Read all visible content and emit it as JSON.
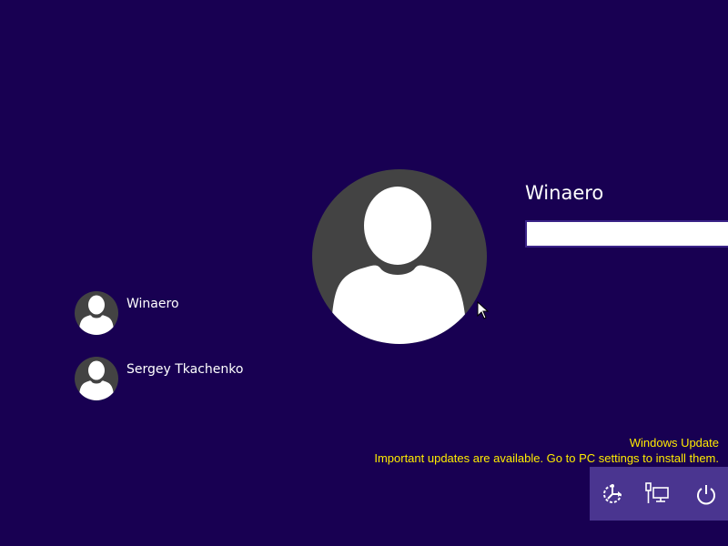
{
  "selected_user": {
    "name": "Winaero",
    "password_placeholder": "",
    "password_value": ""
  },
  "users": [
    {
      "name": "Winaero"
    },
    {
      "name": "Sergey Tkachenko"
    }
  ],
  "notification": {
    "title": "Windows Update",
    "message": "Important updates are available. Go to PC settings to install them."
  },
  "actions": {
    "ease_of_access_icon": "ease-of-access-icon",
    "network_icon": "network-icon",
    "power_icon": "power-icon"
  },
  "colors": {
    "background": "#180052",
    "avatar": "#434343",
    "notification_text": "#ffeb00",
    "action_bar": "#4a3590"
  }
}
